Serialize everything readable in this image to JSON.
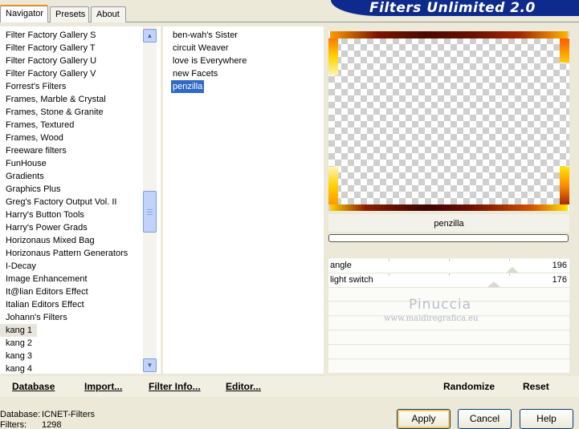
{
  "app_title": "Filters Unlimited 2.0",
  "tabs": [
    {
      "label": "Navigator"
    },
    {
      "label": "Presets"
    },
    {
      "label": "About"
    }
  ],
  "categories": [
    "Filter Factory Gallery S",
    "Filter Factory Gallery T",
    "Filter Factory Gallery U",
    "Filter Factory Gallery V",
    "Forrest's Filters",
    "Frames, Marble & Crystal",
    "Frames, Stone & Granite",
    "Frames, Textured",
    "Frames, Wood",
    "Freeware filters",
    "FunHouse",
    "Gradients",
    "Graphics Plus",
    "Greg's Factory Output Vol. II",
    "Harry's Button Tools",
    "Harry's Power Grads",
    "Horizonaus Mixed Bag",
    "Horizonaus Pattern Generators",
    "I-Decay",
    "Image Enhancement",
    "It@lian Editors Effect",
    "Italian Editors Effect",
    "Johann's Filters",
    "kang 1",
    "kang 2",
    "kang 3",
    "kang 4"
  ],
  "selected_category": "kang 1",
  "filters": [
    "ben-wah's Sister",
    "circuit Weaver",
    "love is Everywhere",
    "new Facets",
    "penzilla"
  ],
  "selected_filter": "penzilla",
  "preview": {
    "filter_name": "penzilla"
  },
  "params": [
    {
      "label": "angle",
      "value": "196"
    },
    {
      "label": "light switch",
      "value": "176"
    }
  ],
  "watermark": {
    "line1": "Pinuccia",
    "line2": "www.maidiregrafica.eu"
  },
  "toolbar": {
    "database": "Database",
    "import": "Import...",
    "filter_info": "Filter Info...",
    "editor": "Editor...",
    "randomize": "Randomize",
    "reset": "Reset"
  },
  "info": {
    "database_label": "Database:",
    "database_value": "ICNET-Filters",
    "filters_label": "Filters:",
    "filters_value": "1298"
  },
  "buttons": {
    "apply": "Apply",
    "cancel": "Cancel",
    "help": "Help"
  },
  "colors": {
    "banner": "#0e2a8c",
    "selection": "#316ac5",
    "button_border": "#003c74"
  }
}
